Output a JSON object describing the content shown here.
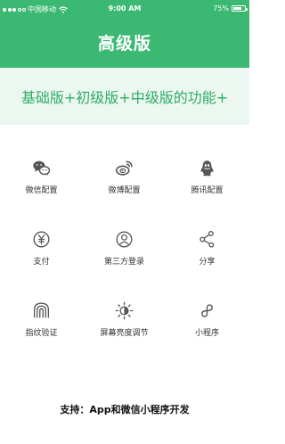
{
  "status_bar": {
    "carrier": "中国移动",
    "time": "9:00 AM",
    "battery": "75%",
    "battery_level": 0.75
  },
  "header": {
    "title": "高级版"
  },
  "banner": {
    "text": "基础版+初级版+中级版的功能+"
  },
  "features": [
    {
      "label": "微信配置",
      "icon": "wechat-icon"
    },
    {
      "label": "微博配置",
      "icon": "weibo-icon"
    },
    {
      "label": "腾讯配置",
      "icon": "qq-icon"
    },
    {
      "label": "支付",
      "icon": "yuan-icon"
    },
    {
      "label": "第三方登录",
      "icon": "user-icon"
    },
    {
      "label": "分享",
      "icon": "share-icon"
    },
    {
      "label": "指纹验证",
      "icon": "fingerprint-icon"
    },
    {
      "label": "屏幕亮度调节",
      "icon": "brightness-icon"
    },
    {
      "label": "小程序",
      "icon": "mini-program-icon"
    }
  ],
  "footer": {
    "text": "支持：App和微信小程序开发"
  },
  "colors": {
    "primary": "#3bb872",
    "banner_bg": "#ebf7f0",
    "banner_text": "#2fae66",
    "icon": "#555555"
  }
}
